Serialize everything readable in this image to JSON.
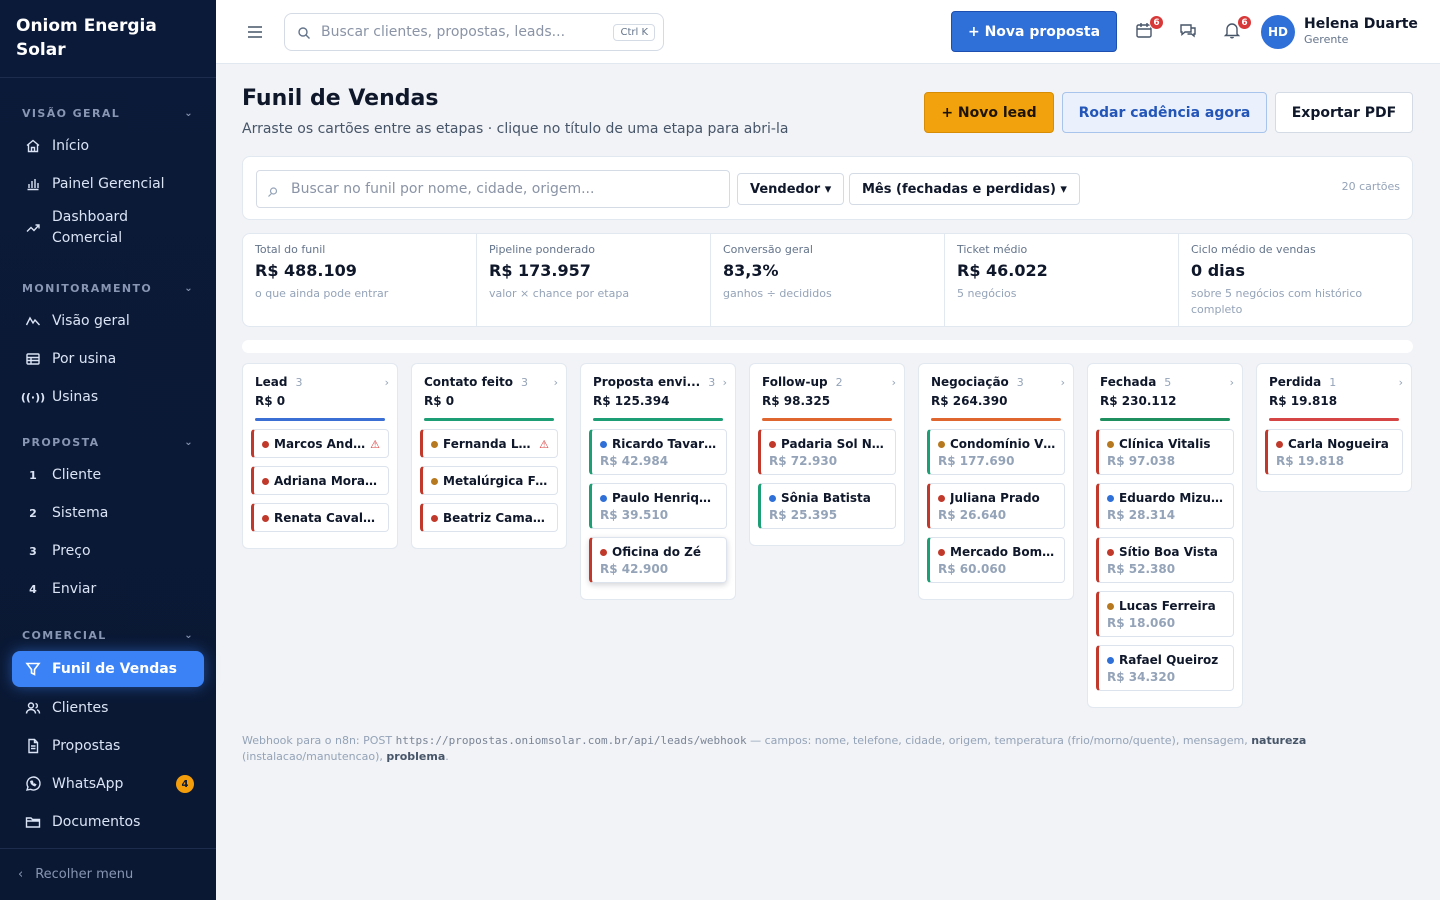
{
  "brand": {
    "line1": "Oniom Energia",
    "line2": "Solar"
  },
  "sidebar": {
    "sections": [
      {
        "title": "VISÃO GERAL",
        "items": [
          {
            "label": "Início",
            "icon": "home-icon"
          },
          {
            "label": "Painel Gerencial",
            "icon": "bar-chart-icon"
          },
          {
            "label": "Dashboard Comercial",
            "icon": "trend-icon"
          }
        ]
      },
      {
        "title": "MONITORAMENTO",
        "items": [
          {
            "label": "Visão geral",
            "icon": "pulse-icon"
          },
          {
            "label": "Por usina",
            "icon": "table-icon"
          },
          {
            "label": "Usinas",
            "icon": "signal-icon"
          }
        ]
      },
      {
        "title": "PROPOSTA",
        "items": [
          {
            "num": "1",
            "label": "Cliente"
          },
          {
            "num": "2",
            "label": "Sistema"
          },
          {
            "num": "3",
            "label": "Preço"
          },
          {
            "num": "4",
            "label": "Enviar"
          }
        ]
      },
      {
        "title": "COMERCIAL",
        "items": [
          {
            "label": "Funil de Vendas",
            "icon": "funnel-icon",
            "active": true
          },
          {
            "label": "Clientes",
            "icon": "users-icon"
          },
          {
            "label": "Propostas",
            "icon": "document-icon"
          },
          {
            "label": "WhatsApp",
            "icon": "whatsapp-icon",
            "badge": "4"
          },
          {
            "label": "Documentos",
            "icon": "folder-icon"
          }
        ]
      }
    ],
    "collapse_label": "Recolher menu"
  },
  "topbar": {
    "search_placeholder": "Buscar clientes, propostas, leads...",
    "shortcut": "Ctrl K",
    "new_proposal": "+ Nova proposta",
    "calendar_badge": "6",
    "bell_badge": "6",
    "user": {
      "initials": "HD",
      "name": "Helena Duarte",
      "role": "Gerente"
    }
  },
  "page": {
    "title": "Funil de Vendas",
    "subtitle": "Arraste os cartões entre as etapas · clique no título de uma etapa para abri-la",
    "btn_new_lead": "+ Novo lead",
    "btn_cadence": "Rodar cadência agora",
    "btn_pdf": "Exportar PDF"
  },
  "filters": {
    "search_placeholder": "Buscar no funil por nome, cidade, origem...",
    "seller": "Vendedor ▾",
    "month": "Mês (fechadas e perdidas) ▾",
    "count": "20 cartões"
  },
  "kpis": [
    {
      "label": "Total do funil",
      "value": "R$ 488.109",
      "note": "o que ainda pode entrar"
    },
    {
      "label": "Pipeline ponderado",
      "value": "R$ 173.957",
      "note": "valor × chance por etapa"
    },
    {
      "label": "Conversão geral",
      "value": "83,3%",
      "note": "ganhos ÷ decididos"
    },
    {
      "label": "Ticket médio",
      "value": "R$ 46.022",
      "note": "5 negócios"
    },
    {
      "label": "Ciclo médio de vendas",
      "value": "0 dias",
      "note": "sobre 5 negócios com histórico completo"
    }
  ],
  "columns": [
    {
      "name": "Lead",
      "count": "3",
      "total": "R$ 0",
      "color": "#3b6fd4",
      "cards": [
        {
          "name": "Marcos Andr...",
          "dot": "#c0392b",
          "border": "#c0392b",
          "warn": true
        },
        {
          "name": "Adriana Moraes",
          "dot": "#c0392b",
          "border": "#c0392b"
        },
        {
          "name": "Renata Cavalca...",
          "dot": "#c0392b",
          "border": "#c0392b"
        }
      ]
    },
    {
      "name": "Contato feito",
      "count": "3",
      "total": "R$ 0",
      "color": "#1e9e75",
      "cards": [
        {
          "name": "Fernanda Lo...",
          "dot": "#b7791f",
          "border": "#c0392b",
          "warn": true
        },
        {
          "name": "Metalúrgica Fe...",
          "dot": "#b7791f",
          "border": "#c0392b"
        },
        {
          "name": "Beatriz Camargo",
          "dot": "#c0392b",
          "border": "#c0392b"
        }
      ]
    },
    {
      "name": "Proposta envi...",
      "count": "3",
      "total": "R$ 125.394",
      "color": "#1e9e75",
      "cards": [
        {
          "name": "Ricardo Tavares",
          "value": "R$ 42.984",
          "dot": "#2f6fd8",
          "border": "#1e9e75"
        },
        {
          "name": "Paulo Henrique...",
          "value": "R$ 39.510",
          "dot": "#2f6fd8",
          "border": "#1e9e75"
        },
        {
          "name": "Oficina do Zé",
          "value": "R$ 42.900",
          "dot": "#c0392b",
          "border": "#c0392b",
          "selected": true
        }
      ]
    },
    {
      "name": "Follow-up",
      "count": "2",
      "total": "R$ 98.325",
      "color": "#e0662f",
      "cards": [
        {
          "name": "Padaria Sol Na...",
          "value": "R$ 72.930",
          "dot": "#c0392b",
          "border": "#c0392b"
        },
        {
          "name": "Sônia Batista",
          "value": "R$ 25.395",
          "dot": "#2f6fd8",
          "border": "#1e9e75"
        }
      ]
    },
    {
      "name": "Negociação",
      "count": "3",
      "total": "R$ 264.390",
      "color": "#e0662f",
      "cards": [
        {
          "name": "Condomínio Vil...",
          "value": "R$ 177.690",
          "dot": "#b7791f",
          "border": "#1e9e75"
        },
        {
          "name": "Juliana Prado",
          "value": "R$ 26.640",
          "dot": "#c0392b",
          "border": "#c0392b"
        },
        {
          "name": "Mercado Bom ...",
          "value": "R$ 60.060",
          "dot": "#c0392b",
          "border": "#1e9e75"
        }
      ]
    },
    {
      "name": "Fechada",
      "count": "5",
      "total": "R$ 230.112",
      "color": "#1f8f5f",
      "cards": [
        {
          "name": "Clínica Vitalis",
          "value": "R$ 97.038",
          "dot": "#b7791f",
          "border": "#c0392b"
        },
        {
          "name": "Eduardo Mizuno",
          "value": "R$ 28.314",
          "dot": "#2f6fd8",
          "border": "#c0392b"
        },
        {
          "name": "Sítio Boa Vista",
          "value": "R$ 52.380",
          "dot": "#c0392b",
          "border": "#c0392b"
        },
        {
          "name": "Lucas Ferreira",
          "value": "R$ 18.060",
          "dot": "#b7791f",
          "border": "#c0392b"
        },
        {
          "name": "Rafael Queiroz",
          "value": "R$ 34.320",
          "dot": "#2f6fd8",
          "border": "#c0392b"
        }
      ]
    },
    {
      "name": "Perdida",
      "count": "1",
      "total": "R$ 19.818",
      "color": "#d64545",
      "cards": [
        {
          "name": "Carla Nogueira",
          "value": "R$ 19.818",
          "dot": "#c0392b",
          "border": "#c0392b"
        }
      ]
    }
  ],
  "footer": {
    "prefix": "Webhook para o n8n: POST",
    "url": "https://propostas.oniomsolar.com.br/api/leads/webhook",
    "mid": "— campos: nome, telefone, cidade, origem, temperatura (frio/morno/quente), mensagem,",
    "bold1": "natureza",
    "mid2": "(instalacao/manutencao),",
    "bold2": "problema",
    "end": "."
  }
}
